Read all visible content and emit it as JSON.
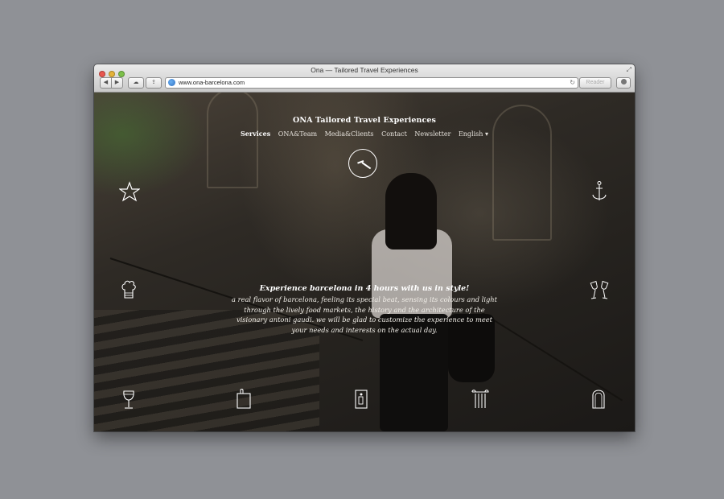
{
  "browser": {
    "window_title": "Ona — Tailored Travel Experiences",
    "url": "www.ona-barcelona.com",
    "reader_label": "Reader"
  },
  "site": {
    "brand": "ONA Tailored Travel Experiences",
    "nav": [
      "Services",
      "ONA&Team",
      "Media&Clients",
      "Contact",
      "Newsletter",
      "English ▾"
    ],
    "active_nav": "Services",
    "headline": "Experience barcelona in 4 hours with us in style!",
    "body": "a real flavor of barcelona, feeling its special beat, sensing its colours and light through the lively food markets, the history and the architecture of the visionary antoni gaudi. we will be glad to customize the experience to meet your needs and interests on the actual day."
  },
  "icons": [
    "clock-icon",
    "star-icon",
    "anchor-icon",
    "chef-hat-icon",
    "champagne-glasses-icon",
    "wine-glass-icon",
    "shopping-bag-icon",
    "door-icon",
    "column-icon",
    "arch-icon"
  ],
  "colors": {
    "page_bg": "#8f9196",
    "content_bg": "#2b2723",
    "text": "#ffffff"
  }
}
